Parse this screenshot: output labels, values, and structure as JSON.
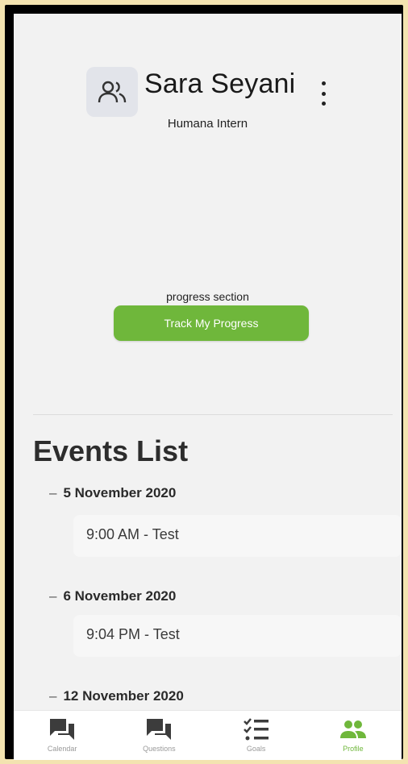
{
  "profile": {
    "name": "Sara Seyani",
    "role": "Humana Intern"
  },
  "progress": {
    "label": "progress section",
    "button_label": "Track My Progress"
  },
  "events": {
    "title": "Events List",
    "groups": [
      {
        "date": "5 November 2020",
        "items": [
          "9:00 AM - Test"
        ]
      },
      {
        "date": "6 November 2020",
        "items": [
          "9:04 PM - Test"
        ]
      },
      {
        "date": "12 November 2020",
        "items": []
      }
    ]
  },
  "nav": {
    "items": [
      {
        "label": "Calendar",
        "icon": "chat-bubbles-icon"
      },
      {
        "label": "Questions",
        "icon": "chat-bubbles-icon"
      },
      {
        "label": "Goals",
        "icon": "checklist-icon"
      },
      {
        "label": "Profile",
        "icon": "people-icon"
      }
    ],
    "active_index": 3
  },
  "colors": {
    "accent": "#6fb73b",
    "background": "#f2f2f2"
  }
}
